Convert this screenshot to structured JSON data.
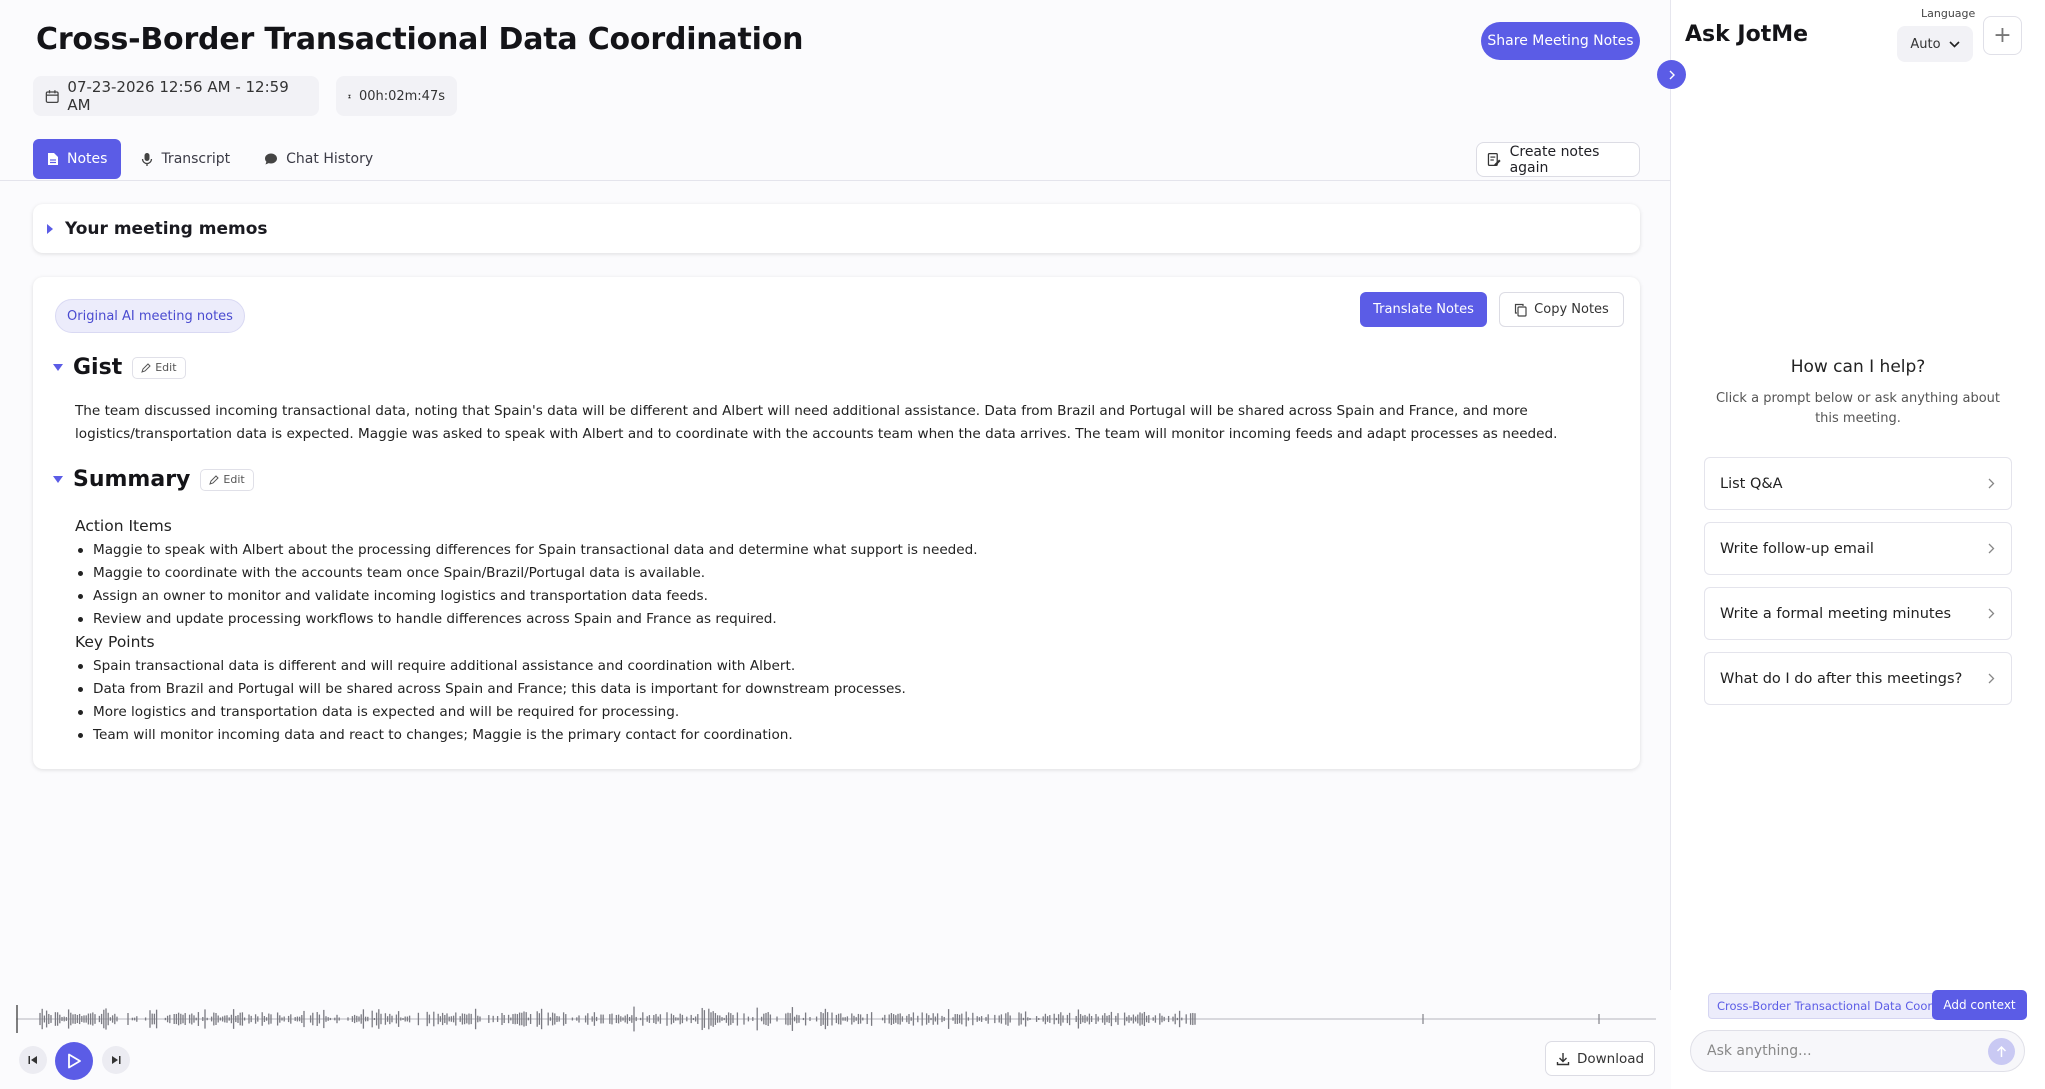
{
  "header": {
    "title": "Cross-Border Transactional Data Coordination",
    "share_label": "Share Meeting Notes",
    "datetime": "07-23-2026 12:56 AM - 12:59 AM",
    "duration": "00h:02m:47s"
  },
  "tabs": [
    {
      "label": "Notes",
      "icon": "document-icon",
      "active": true
    },
    {
      "label": "Transcript",
      "icon": "microphone-icon",
      "active": false
    },
    {
      "label": "Chat History",
      "icon": "chat-bubble-icon",
      "active": false
    }
  ],
  "create_notes_label": "Create notes again",
  "memos_label": "Your meeting memos",
  "notes": {
    "badge": "Original AI meeting notes",
    "translate_label": "Translate Notes",
    "copy_label": "Copy Notes",
    "edit_label": "Edit",
    "gist_title": "Gist",
    "gist_text": "The team discussed incoming transactional data, noting that Spain's data will be different and Albert will need additional assistance. Data from Brazil and Portugal will be shared across Spain and France, and more logistics/transportation data is expected. Maggie was asked to speak with Albert and to coordinate with the accounts team when the data arrives. The team will monitor incoming feeds and adapt processes as needed.",
    "summary_title": "Summary",
    "action_items_title": "Action Items",
    "action_items": [
      "Maggie to speak with Albert about the processing differences for Spain transactional data and determine what support is needed.",
      "Maggie to coordinate with the accounts team once Spain/Brazil/Portugal data is available.",
      "Assign an owner to monitor and validate incoming logistics and transportation data feeds.",
      "Review and update processing workflows to handle differences across Spain and France as required."
    ],
    "key_points_title": "Key Points",
    "key_points": [
      "Spain transactional data is different and will require additional assistance and coordination with Albert.",
      "Data from Brazil and Portugal will be shared across Spain and France; this data is important for downstream processes.",
      "More logistics and transportation data is expected and will be required for processing.",
      "Team will monitor incoming data and react to changes; Maggie is the primary contact for coordination."
    ]
  },
  "player": {
    "download_label": "Download"
  },
  "sidebar": {
    "title": "Ask JotMe",
    "language_label": "Language",
    "language_value": "Auto",
    "help_title": "How can I help?",
    "help_subtitle": "Click a prompt below or ask anything about this meeting.",
    "prompts": [
      "List Q&A",
      "Write follow-up email",
      "Write a formal meeting minutes",
      "What do I do after this meetings?"
    ],
    "context_chip": "Cross-Border Transactional Data Coordination",
    "add_context_label": "Add context",
    "ask_placeholder": "Ask anything..."
  },
  "colors": {
    "accent": "#5b5ce6",
    "accent_light": "#ececfb",
    "text": "#1f1f24"
  }
}
